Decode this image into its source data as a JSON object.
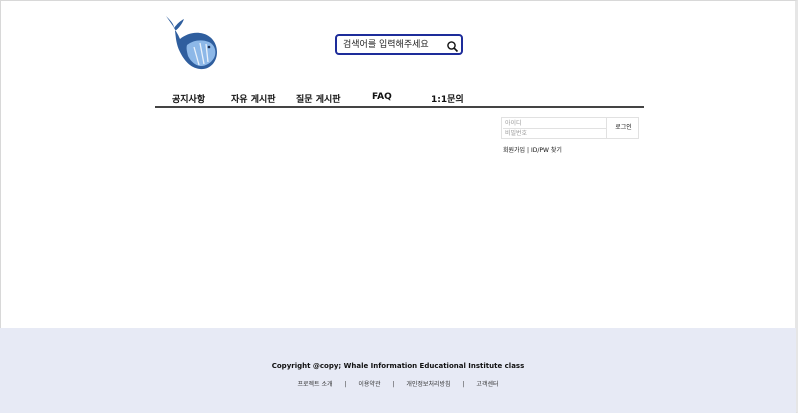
{
  "header": {
    "logo_icon": "whale-logo-icon",
    "search": {
      "placeholder": "검색어를 입력해주세요",
      "value": "",
      "icon": "search-icon",
      "border_color": "#1d2c9a"
    }
  },
  "nav": {
    "items": [
      {
        "label": "공지사항"
      },
      {
        "label": "자유 게시판"
      },
      {
        "label": "질문 게시판"
      },
      {
        "label": "FAQ"
      },
      {
        "label": "1:1문의"
      }
    ]
  },
  "login": {
    "id_placeholder": "아이디",
    "pw_placeholder": "비밀번호",
    "button_label": "로그인",
    "signup_label": "회원가입",
    "separator": "|",
    "find_label": "ID/PW 찾기"
  },
  "footer": {
    "copyright": "Copyright @copy; Whale Information Educational Institute class",
    "links": [
      {
        "label": "프로젝트 소개"
      },
      {
        "label": "이용약관"
      },
      {
        "label": "개인정보처리방침"
      },
      {
        "label": "고객센터"
      }
    ],
    "separator": "|",
    "background": "#e7eaf5"
  }
}
